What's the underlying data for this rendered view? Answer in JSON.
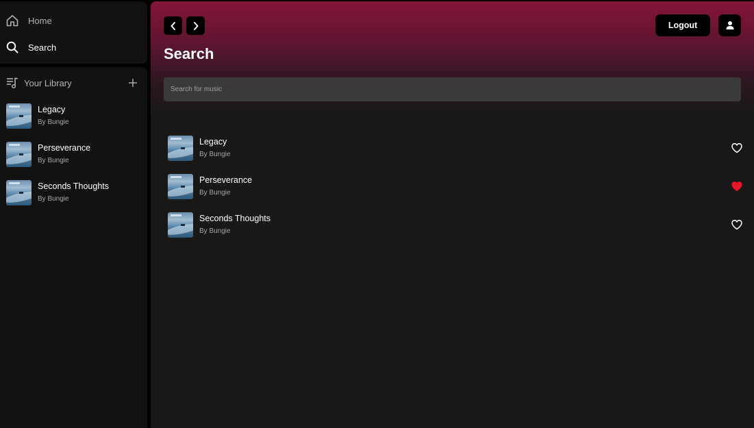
{
  "sidebar": {
    "nav": {
      "home_label": "Home",
      "search_label": "Search"
    },
    "library": {
      "title": "Your Library",
      "items": [
        {
          "title": "Legacy",
          "artist": "By Bungie"
        },
        {
          "title": "Perseverance",
          "artist": "By Bungie"
        },
        {
          "title": "Seconds Thoughts",
          "artist": "By Bungie"
        }
      ]
    }
  },
  "header": {
    "logout_label": "Logout"
  },
  "main": {
    "title": "Search",
    "search": {
      "placeholder": "Search for music",
      "value": ""
    },
    "results": [
      {
        "title": "Legacy",
        "artist": "By Bungie",
        "liked": false
      },
      {
        "title": "Perseverance",
        "artist": "By Bungie",
        "liked": true
      },
      {
        "title": "Seconds Thoughts",
        "artist": "By Bungie",
        "liked": false
      }
    ]
  },
  "icons": {
    "home": "home-icon",
    "search": "search-icon",
    "library": "library-icon",
    "add": "plus-icon",
    "back": "chevron-left-icon",
    "forward": "chevron-right-icon",
    "user": "user-icon",
    "heart": "heart-icon"
  },
  "colors": {
    "accent_gradient_top": "#85143a",
    "liked_heart": "#e91429",
    "panel_bg": "#121212",
    "main_bg": "#181818",
    "search_bg": "#3a3a3a"
  }
}
